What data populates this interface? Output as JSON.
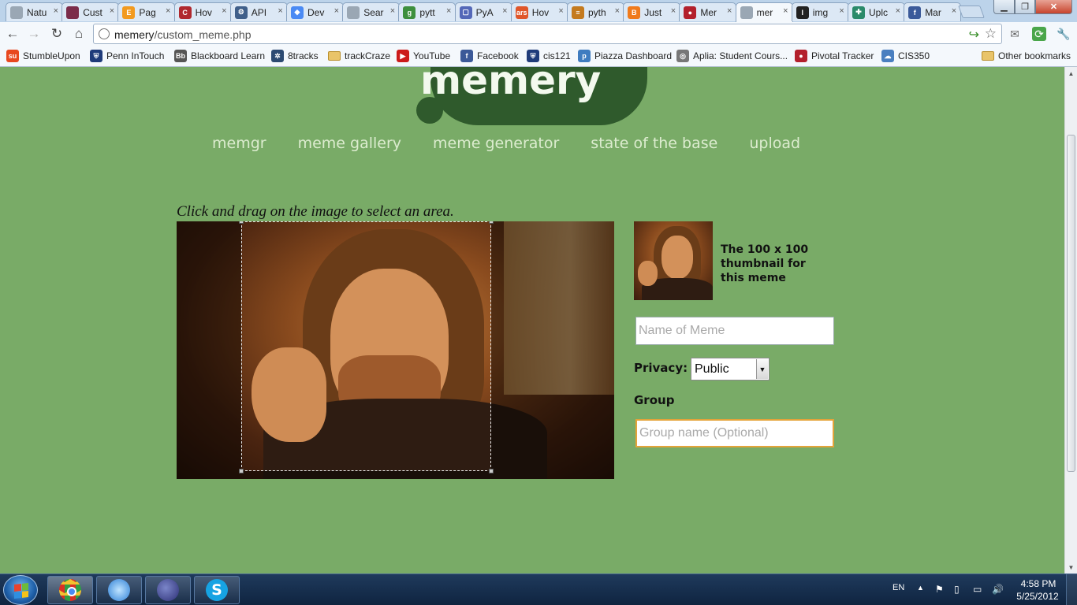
{
  "browser": {
    "tabs": [
      {
        "title": "Natu",
        "color": "#9aa7b4",
        "glyph": ""
      },
      {
        "title": "Cust",
        "color": "#7b2c4a",
        "glyph": ""
      },
      {
        "title": "Pag",
        "color": "#f29a1f",
        "glyph": "E"
      },
      {
        "title": "Hov",
        "color": "#b0282e",
        "glyph": "C"
      },
      {
        "title": "API",
        "color": "#3f5f8a",
        "glyph": "⚙"
      },
      {
        "title": "Dev",
        "color": "#4a8af4",
        "glyph": "◆"
      },
      {
        "title": "Sear",
        "color": "#9aa7b4",
        "glyph": ""
      },
      {
        "title": "pytt",
        "color": "#3d8f3d",
        "glyph": "g"
      },
      {
        "title": "PyA",
        "color": "#5468b8",
        "glyph": "▢"
      },
      {
        "title": "Hov",
        "color": "#e0562a",
        "glyph": "ars"
      },
      {
        "title": "pyth",
        "color": "#c47a1e",
        "glyph": "≡"
      },
      {
        "title": "Just",
        "color": "#f07a1b",
        "glyph": "B"
      },
      {
        "title": "Mer",
        "color": "#b3202c",
        "glyph": "●"
      },
      {
        "title": "mer",
        "color": "#9aa7b4",
        "glyph": ""
      },
      {
        "title": "img",
        "color": "#222222",
        "glyph": "I"
      },
      {
        "title": "Uplc",
        "color": "#2a8a6a",
        "glyph": "✚"
      },
      {
        "title": "Mar",
        "color": "#3b5a9a",
        "glyph": "f"
      }
    ],
    "active_tab_index": 13,
    "url_host": "memery",
    "url_path": "/custom_meme.php",
    "bookmarks": [
      {
        "label": "StumbleUpon",
        "icon": "stumbleupon-icon",
        "color": "#e8481f",
        "glyph": "su"
      },
      {
        "label": "Penn InTouch",
        "icon": "penn-shield-icon",
        "color": "#1f3b7a",
        "glyph": "⛨"
      },
      {
        "label": "Blackboard Learn",
        "icon": "blackboard-icon",
        "color": "#555555",
        "glyph": "Bb"
      },
      {
        "label": "8tracks",
        "icon": "8tracks-icon",
        "color": "#2c4a72",
        "glyph": "✲"
      },
      {
        "label": "trackCraze",
        "icon": "folder-icon",
        "color": "",
        "glyph": ""
      },
      {
        "label": "YouTube",
        "icon": "youtube-icon",
        "color": "#cc1b1b",
        "glyph": "▶"
      },
      {
        "label": "Facebook",
        "icon": "facebook-icon",
        "color": "#3b5998",
        "glyph": "f"
      },
      {
        "label": "cis121",
        "icon": "penn-shield-icon",
        "color": "#1f3b7a",
        "glyph": "⛨"
      },
      {
        "label": "Piazza Dashboard",
        "icon": "piazza-icon",
        "color": "#3f7cc0",
        "glyph": "p"
      },
      {
        "label": "Aplia: Student Cours...",
        "icon": "aplia-icon",
        "color": "#777777",
        "glyph": "◎"
      },
      {
        "label": "Pivotal Tracker",
        "icon": "pivotal-icon",
        "color": "#b3202c",
        "glyph": "●"
      },
      {
        "label": "CIS350",
        "icon": "cis350-icon",
        "color": "#4a7fc0",
        "glyph": "☁"
      }
    ],
    "other_bookmarks": "Other bookmarks"
  },
  "site": {
    "logo_text": "memery",
    "nav": [
      "memgr",
      "meme gallery",
      "meme generator",
      "state of the base",
      "upload"
    ]
  },
  "editor": {
    "instruction": "Click and drag on the image to select an area.",
    "thumbnail_caption": "The 100 x 100 thumbnail for this meme",
    "name_placeholder": "Name of Meme",
    "privacy_label": "Privacy:",
    "privacy_value": "Public",
    "group_label": "Group",
    "group_placeholder": "Group name (Optional)"
  },
  "taskbar": {
    "language": "EN",
    "time": "4:58 PM",
    "date": "5/25/2012"
  }
}
